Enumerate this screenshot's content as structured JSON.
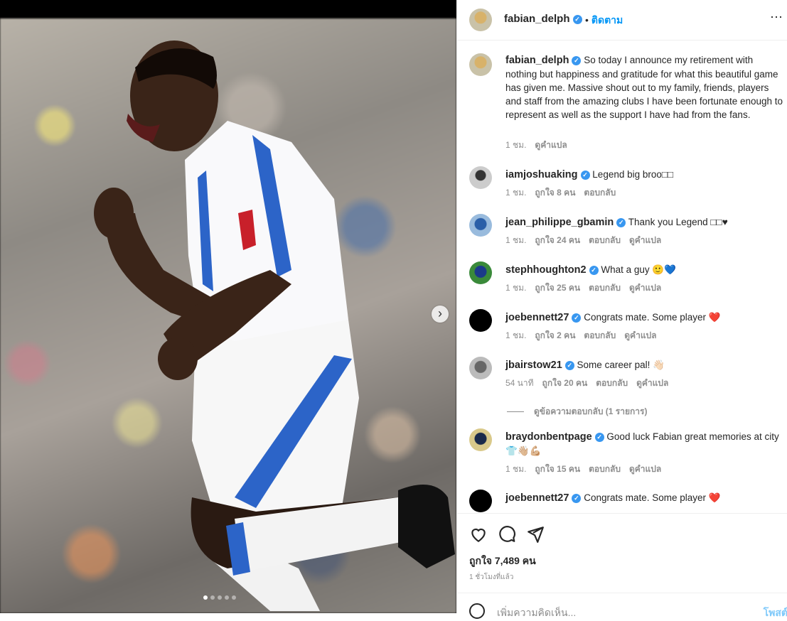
{
  "post": {
    "author": "fabian_delph",
    "follow_label": "ติดตาม",
    "caption": "So today I announce my retirement with nothing but happiness and gratitude for what this beautiful game has given me. Massive shout out to my family, friends, players and staff from the amazing clubs I have been fortunate enough to represent as well as the support I have had from the fans.",
    "caption_time": "1 ชม.",
    "see_translation": "ดูคำแปล",
    "likes": "ถูกใจ 7,489 คน",
    "posted_time": "1 ชั่วโมงที่แล้ว",
    "add_comment_placeholder": "เพิ่มความคิดเห็น...",
    "post_label": "โพสต์"
  },
  "comments": [
    {
      "user": "iamjoshuaking",
      "text": "Legend big broo□□",
      "time": "1 ชม.",
      "likes": "ถูกใจ 8 คน",
      "reply": "ตอบกลับ",
      "translate": ""
    },
    {
      "user": "jean_philippe_gbamin",
      "text": "Thank you Legend □□♥",
      "time": "1 ชม.",
      "likes": "ถูกใจ 24 คน",
      "reply": "ตอบกลับ",
      "translate": "ดูคำแปล"
    },
    {
      "user": "stephhoughton2",
      "text": "What a guy 🙂💙",
      "time": "1 ชม.",
      "likes": "ถูกใจ 25 คน",
      "reply": "ตอบกลับ",
      "translate": "ดูคำแปล"
    },
    {
      "user": "joebennett27",
      "text": "Congrats mate. Some player ❤️",
      "time": "1 ชม.",
      "likes": "ถูกใจ 2 คน",
      "reply": "ตอบกลับ",
      "translate": "ดูคำแปล"
    },
    {
      "user": "jbairstow21",
      "text": "Some career pal! 👋🏻",
      "time": "54 นาที",
      "likes": "ถูกใจ 20 คน",
      "reply": "ตอบกลับ",
      "translate": "ดูคำแปล"
    },
    {
      "user": "braydonbentpage",
      "text": "Good luck Fabian great memories at city 👕👋🏼💪🏼",
      "time": "1 ชม.",
      "likes": "ถูกใจ 15 คน",
      "reply": "ตอบกลับ",
      "translate": "ดูคำแปล"
    },
    {
      "user": "joebennett27",
      "text": "Congrats mate. Some player ❤️",
      "time": "",
      "likes": "",
      "reply": "",
      "translate": ""
    }
  ],
  "view_replies": "ดูข้อความตอบกลับ (1 รายการ)",
  "icons": [
    "heart-icon",
    "comment-icon",
    "share-icon",
    "emoji-icon",
    "next-arrow-icon",
    "verified-icon",
    "more-options-icon"
  ],
  "colors": {
    "accent": "#0095f6",
    "verified": "#3897f0",
    "muted": "#8e8e8e"
  }
}
